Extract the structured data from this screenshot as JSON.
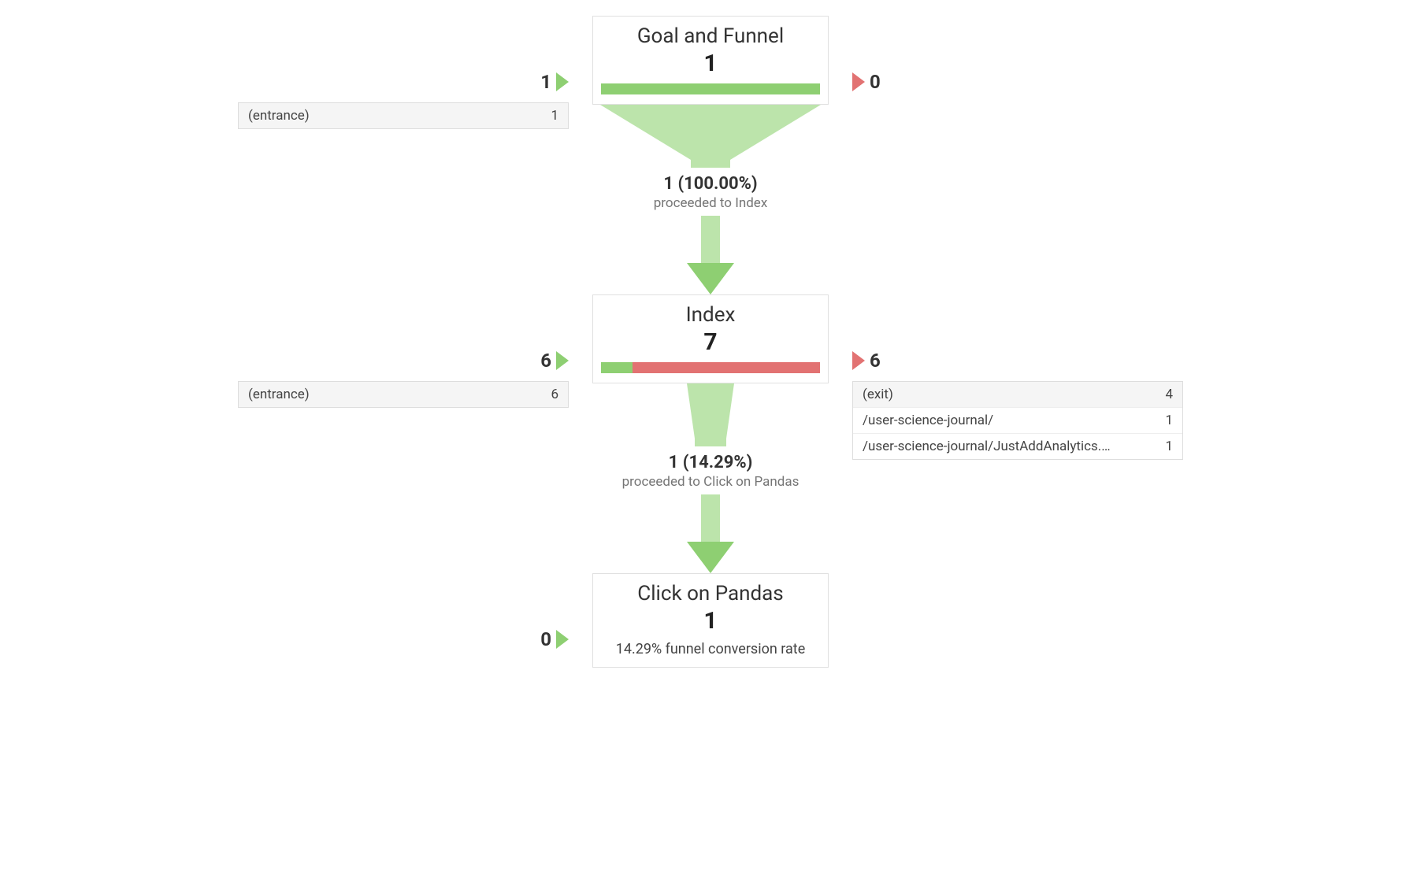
{
  "chart_data": {
    "type": "funnel",
    "steps": [
      {
        "name": "Goal and Funnel",
        "count": 1,
        "proceeded_pct": 100.0,
        "dropoff_pct": 0
      },
      {
        "name": "Index",
        "count": 7,
        "proceeded_pct": 14.29,
        "dropoff_pct": 85.71
      },
      {
        "name": "Click on Pandas",
        "count": 1
      }
    ],
    "overall_conversion_pct": 14.29
  },
  "step1": {
    "title": "Goal and Funnel",
    "count": "1",
    "in_count": "1",
    "out_count": "0",
    "in_paths": [
      {
        "label": "(entrance)",
        "value": "1"
      }
    ],
    "connector_main": "1 (100.00%)",
    "connector_sub": "proceeded to Index"
  },
  "step2": {
    "title": "Index",
    "count": "7",
    "in_count": "6",
    "out_count": "6",
    "in_paths": [
      {
        "label": "(entrance)",
        "value": "6"
      }
    ],
    "out_paths": [
      {
        "label": "(exit)",
        "value": "4"
      },
      {
        "label": "/user-science-journal/",
        "value": "1"
      },
      {
        "label": "/user-science-journal/JustAddAnalytics.…",
        "value": "1"
      }
    ],
    "connector_main": "1 (14.29%)",
    "connector_sub": "proceeded to Click on Pandas"
  },
  "step3": {
    "title": "Click on Pandas",
    "count": "1",
    "in_count": "0",
    "conversion_rate": "14.29% funnel conversion rate"
  }
}
